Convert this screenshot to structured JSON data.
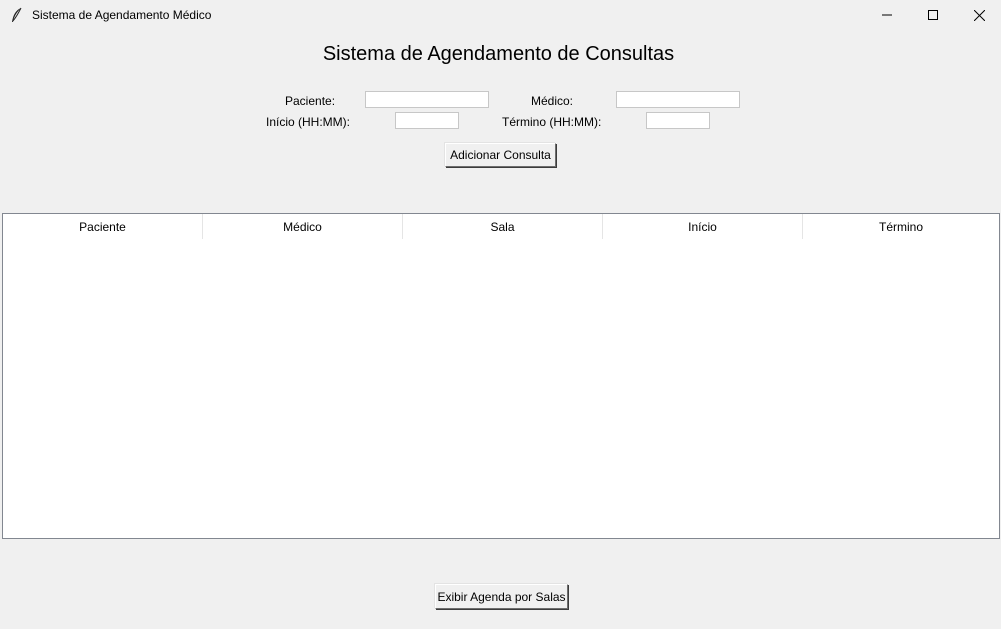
{
  "window": {
    "title": "Sistema de Agendamento Médico",
    "icon": "feather-icon",
    "controls": [
      "minimize-icon",
      "maximize-icon",
      "close-icon"
    ]
  },
  "header": {
    "title": "Sistema de Agendamento de Consultas"
  },
  "form": {
    "paciente_label": "Paciente:",
    "paciente_value": "",
    "medico_label": "Médico:",
    "medico_value": "",
    "inicio_label": "Início (HH:MM):",
    "inicio_value": "",
    "termino_label": "Término (HH:MM):",
    "termino_value": "",
    "add_button_label": "Adicionar Consulta"
  },
  "table": {
    "columns": [
      "Paciente",
      "Médico",
      "Sala",
      "Início",
      "Término"
    ],
    "rows": []
  },
  "footer": {
    "rooms_button_label": "Exibir Agenda por Salas"
  }
}
